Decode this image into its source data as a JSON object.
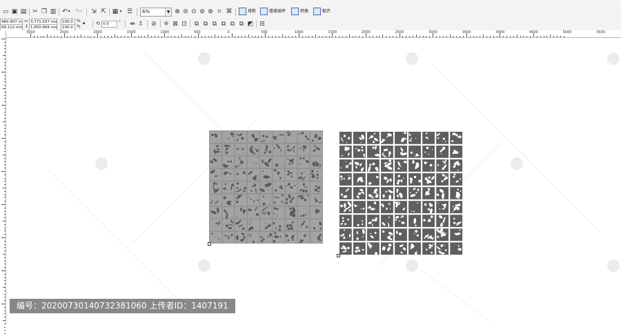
{
  "toolbar": {
    "zoom_value": "6%",
    "buttons": {
      "arrange": "排新",
      "plugins": "楼缘插件",
      "convert": "转换",
      "paste": "黏齐"
    }
  },
  "propertybar": {
    "x": "460.407 mm",
    "y": "99.112 mm",
    "width": "3,771.037 mm",
    "height": "1,850.666 mm",
    "scale_x": "100.0",
    "scale_y": "100.0",
    "percent": "%",
    "rotation": "0.0",
    "degree": "°"
  },
  "ruler": {
    "labels": [
      "3000",
      "2500",
      "2000",
      "1500",
      "1000",
      "500",
      "0",
      "500",
      "1000",
      "1500",
      "2000",
      "2500",
      "3000",
      "3500",
      "4000",
      "4500",
      "5000",
      "5500"
    ]
  },
  "overlay": {
    "uploader_text": "编号：20200730140732381060 上传者ID：1407191"
  }
}
